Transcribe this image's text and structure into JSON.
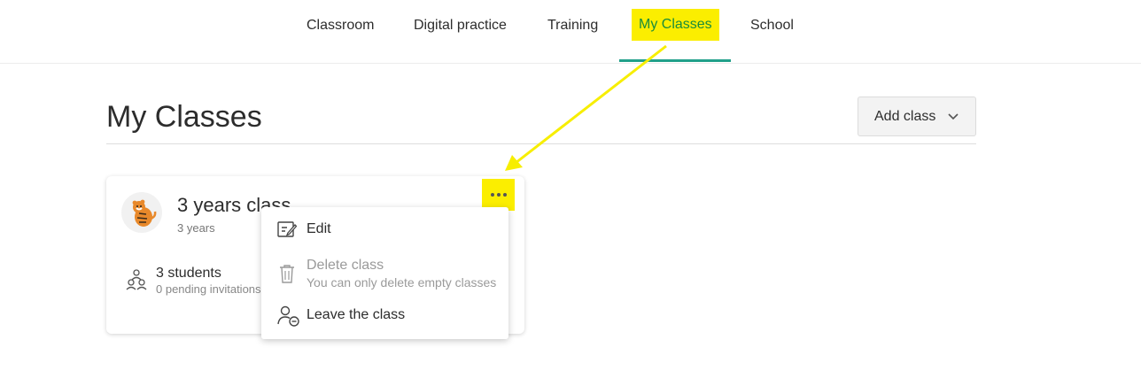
{
  "nav": {
    "items": [
      {
        "label": "Classroom"
      },
      {
        "label": "Digital practice"
      },
      {
        "label": "Training"
      },
      {
        "label": "My Classes",
        "active": true
      },
      {
        "label": "School"
      }
    ],
    "active_color": "#21a08a",
    "highlight_color": "#fbee00"
  },
  "page": {
    "title": "My Classes",
    "add_class_label": "Add class"
  },
  "class_card": {
    "title": "3 years class",
    "subtitle": "3 years",
    "avatar": "tiger-avatar",
    "students": "3 students",
    "pending": "0 pending invitations"
  },
  "menu": {
    "edit": "Edit",
    "delete": "Delete class",
    "delete_note": "You can only delete empty classes",
    "leave": "Leave the class"
  }
}
